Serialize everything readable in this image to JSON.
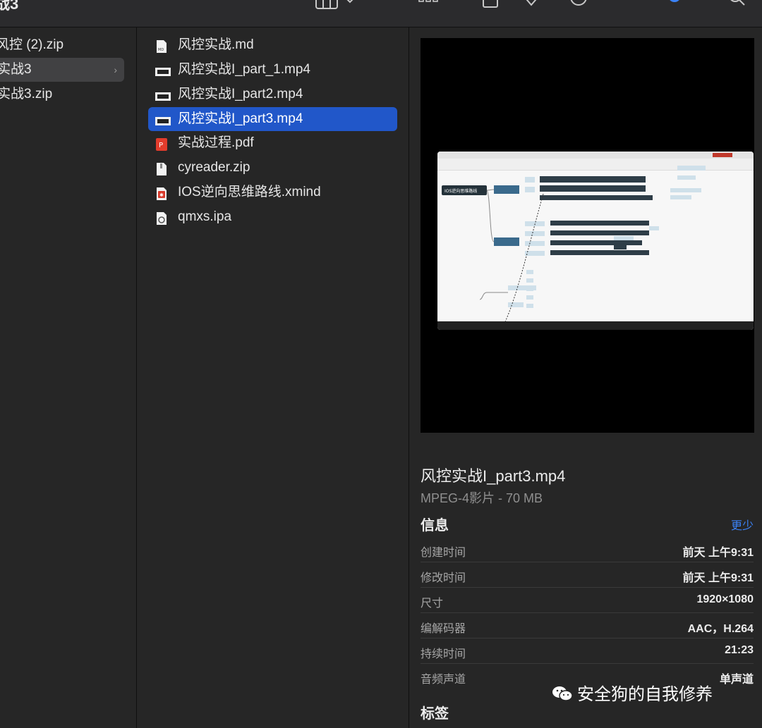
{
  "window": {
    "title": "战3"
  },
  "toolbar": {
    "icons": [
      "column-view-icon",
      "chevron-down-icon",
      "group-icon",
      "share-icon",
      "tag-icon",
      "action-icon",
      "airdrop-icon",
      "search-icon"
    ]
  },
  "column1": {
    "items": [
      {
        "label": "风控 (2).zip"
      },
      {
        "label": "实战3"
      },
      {
        "label": "实战3.zip"
      }
    ]
  },
  "column2": {
    "items": [
      {
        "label": "风控实战.md",
        "icon": "markdown-file-icon"
      },
      {
        "label": "风控实战I_part_1.mp4",
        "icon": "video-file-icon"
      },
      {
        "label": "风控实战I_part2.mp4",
        "icon": "video-file-icon"
      },
      {
        "label": "风控实战I_part3.mp4",
        "icon": "video-file-icon"
      },
      {
        "label": "实战过程.pdf",
        "icon": "pdf-file-icon"
      },
      {
        "label": "cyreader.zip",
        "icon": "zip-file-icon"
      },
      {
        "label": "IOS逆向思维路线.xmind",
        "icon": "xmind-file-icon"
      },
      {
        "label": "qmxs.ipa",
        "icon": "ipa-file-icon"
      }
    ]
  },
  "preview": {
    "title": "风控实战I_part3.mp4",
    "subtitle": "MPEG-4影片 - 70 MB",
    "info_heading": "信息",
    "less_label": "更少",
    "info": [
      {
        "key": "创建时间",
        "value": "前天 上午9:31"
      },
      {
        "key": "修改时间",
        "value": "前天 上午9:31"
      },
      {
        "key": "尺寸",
        "value": "1920×1080"
      },
      {
        "key": "编解码器",
        "value": "AAC，H.264"
      },
      {
        "key": "持续时间",
        "value": "21:23"
      },
      {
        "key": "音频声道",
        "value": "单声道"
      }
    ],
    "tags_heading": "标签",
    "mindmap_root": "IOS逆向思维路线"
  },
  "watermark": "安全狗的自我修养",
  "colors": {
    "selection_blue": "#2157c9",
    "accent_link": "#3b82f6"
  }
}
